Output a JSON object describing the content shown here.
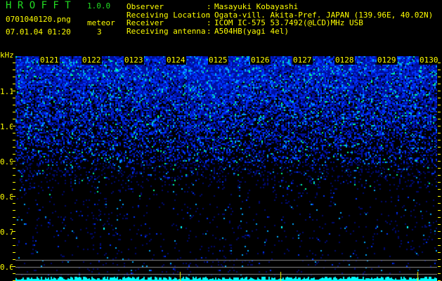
{
  "app": {
    "title": "H R O F F T",
    "version": "1.0.0"
  },
  "file": {
    "name": "0701040120.png",
    "datetime": "07.01.04 01:20"
  },
  "meteor": {
    "label": "meteor",
    "count": "3"
  },
  "info": [
    {
      "label": "Observer",
      "value": "Masayuki Kobayashi"
    },
    {
      "label": "Receiving Location",
      "value": "Ogata-vill. Akita-Pref. JAPAN (139.96E, 40.02N)"
    },
    {
      "label": "Receiver",
      "value": "ICOM IC-575 53.7492(@LCD)MHz USB"
    },
    {
      "label": "Receiving antenna",
      "value": "A504HB(yagi 4el)"
    }
  ],
  "axis": {
    "unit": "kHz",
    "y_labels": [
      "1.1",
      "1.0",
      "0.9",
      "0.8",
      "0.7",
      "0.6"
    ],
    "y_range": [
      0.56,
      1.2
    ]
  },
  "time_labels": [
    "0121",
    "0122",
    "0123",
    "0124",
    "0125",
    "0126",
    "0127",
    "0128",
    "0129",
    "0130"
  ],
  "colors": {
    "text": "#ffff00",
    "title": "#22dd22",
    "signal": "#00ffff",
    "noise": "#0022ff"
  }
}
